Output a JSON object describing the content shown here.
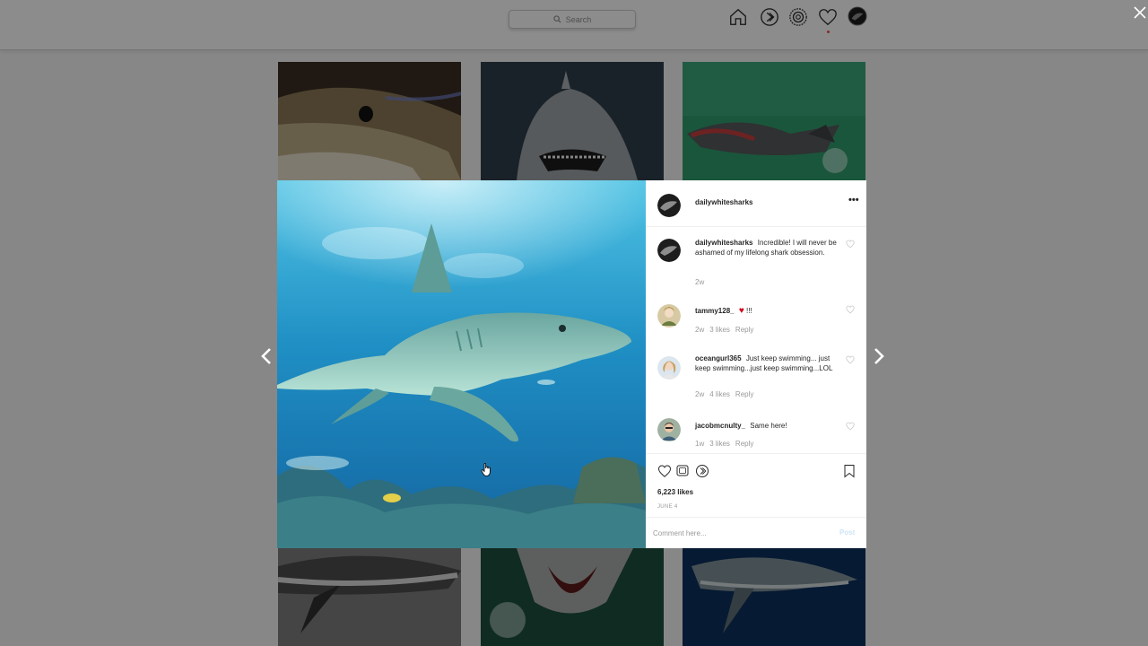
{
  "search": {
    "placeholder": "Search"
  },
  "nav": {
    "icons": [
      "home-icon",
      "direct-icon",
      "explore-icon",
      "activity-heart-icon",
      "profile-avatar"
    ]
  },
  "modal": {
    "close_icon": "close-icon",
    "prev_icon": "chevron-left-icon",
    "next_icon": "chevron-right-icon"
  },
  "post": {
    "author": "dailywhitesharks",
    "more_icon": "•••",
    "likes": "6,223 likes",
    "date": "JUNE 4",
    "actions": [
      "like-heart-icon",
      "comment-icon",
      "share-icon",
      "bookmark-icon"
    ],
    "comment_placeholder": "Comment here...",
    "post_label": "Post"
  },
  "comments": [
    {
      "user": "dailywhitesharks",
      "text": "Incredible! I will never be ashamed of  my lifelong shark obsession.",
      "time": "2w",
      "likes": "",
      "reply": ""
    },
    {
      "user": "tammy128_",
      "text": "!!!",
      "emoji": "♥",
      "time": "2w",
      "likes": "3 likes",
      "reply": "Reply"
    },
    {
      "user": "oceangurl365",
      "text": "Just keep swimming... just keep swimming...just keep swimming...LOL",
      "time": "2w",
      "likes": "4 likes",
      "reply": "Reply"
    },
    {
      "user": "jacobmcnulty_",
      "text": "Same here!",
      "time": "1w",
      "likes": "3 likes",
      "reply": "Reply"
    }
  ],
  "colors": {
    "heart_red": "#ed4956",
    "link_blue": "#cde5f7",
    "muted": "#999999"
  }
}
